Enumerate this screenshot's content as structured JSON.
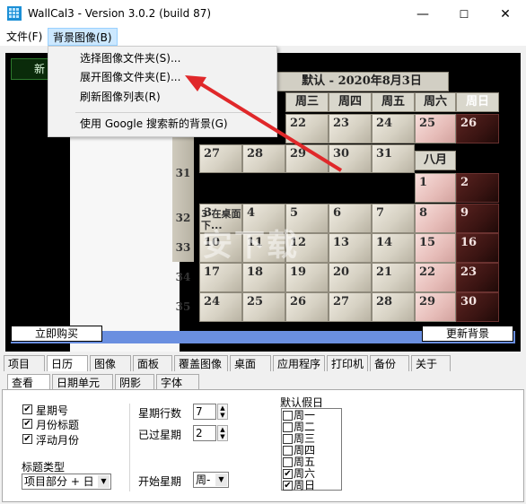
{
  "window": {
    "title": "WallCal3 - Version 3.0.2 (build 87)",
    "controls": {
      "minimize": "—",
      "maximize": "☐",
      "close": "✕"
    }
  },
  "menubar": {
    "file": "文件(F)",
    "background": "背景图像(B)"
  },
  "dropdown": {
    "items": [
      "选择图像文件夹(S)...",
      "展开图像文件夹(E)...",
      "刷新图像列表(R)",
      "使用 Google 搜索新的背景(G)"
    ]
  },
  "calendar": {
    "green_label": "新",
    "month_title": "默认 - 2020年8月3日",
    "weekday_headers": [
      "周三",
      "周四",
      "周五",
      "周六",
      "周日"
    ],
    "month_label": "八月",
    "week_numbers": [
      "31",
      "32",
      "33",
      "34",
      "35"
    ],
    "overlap_text": "3 在桌面下...",
    "row_prev_a": [
      "22",
      "23",
      "24",
      "25",
      "26"
    ],
    "row_prev_b": [
      "27",
      "28",
      "29",
      "30",
      "31"
    ],
    "aug_weekend_1": [
      "1",
      "2"
    ],
    "rows": [
      [
        "3",
        "4",
        "5",
        "6",
        "7",
        "8",
        "9"
      ],
      [
        "10",
        "11",
        "12",
        "13",
        "14",
        "15",
        "16"
      ],
      [
        "17",
        "18",
        "19",
        "20",
        "21",
        "22",
        "23"
      ],
      [
        "24",
        "25",
        "26",
        "27",
        "28",
        "29",
        "30"
      ]
    ],
    "buy_button": "立即购买",
    "refresh_bg_button": "更新背景"
  },
  "main_tabs": [
    "项目",
    "日历",
    "图像",
    "面板",
    "覆盖图像",
    "桌面",
    "应用程序",
    "打印机",
    "备份",
    "关于"
  ],
  "sub_tabs": [
    "查看",
    "日期单元格",
    "阴影",
    "字体"
  ],
  "view_panel": {
    "checkboxes": [
      {
        "label": "星期号",
        "checked": true
      },
      {
        "label": "月份标题",
        "checked": true
      },
      {
        "label": "浮动月份",
        "checked": true
      }
    ],
    "title_type_label": "标题类型",
    "title_type_value": "项目部分 + 日",
    "week_rows_label": "星期行数",
    "week_rows_value": "7",
    "past_weeks_label": "已过星期",
    "past_weeks_value": "2",
    "start_week_label": "开始星期",
    "start_week_value": "周-",
    "holiday_label": "默认假日",
    "holidays": [
      {
        "label": "周一",
        "checked": false
      },
      {
        "label": "周二",
        "checked": false
      },
      {
        "label": "周三",
        "checked": false
      },
      {
        "label": "周四",
        "checked": false
      },
      {
        "label": "周五",
        "checked": false
      },
      {
        "label": "周六",
        "checked": true
      },
      {
        "label": "周日",
        "checked": true
      }
    ]
  },
  "watermark_text": "安下载",
  "colors": {
    "accent_arrow": "#e0282a",
    "menu_highlight": "#cce8ff",
    "weekend": "#3a1412"
  }
}
